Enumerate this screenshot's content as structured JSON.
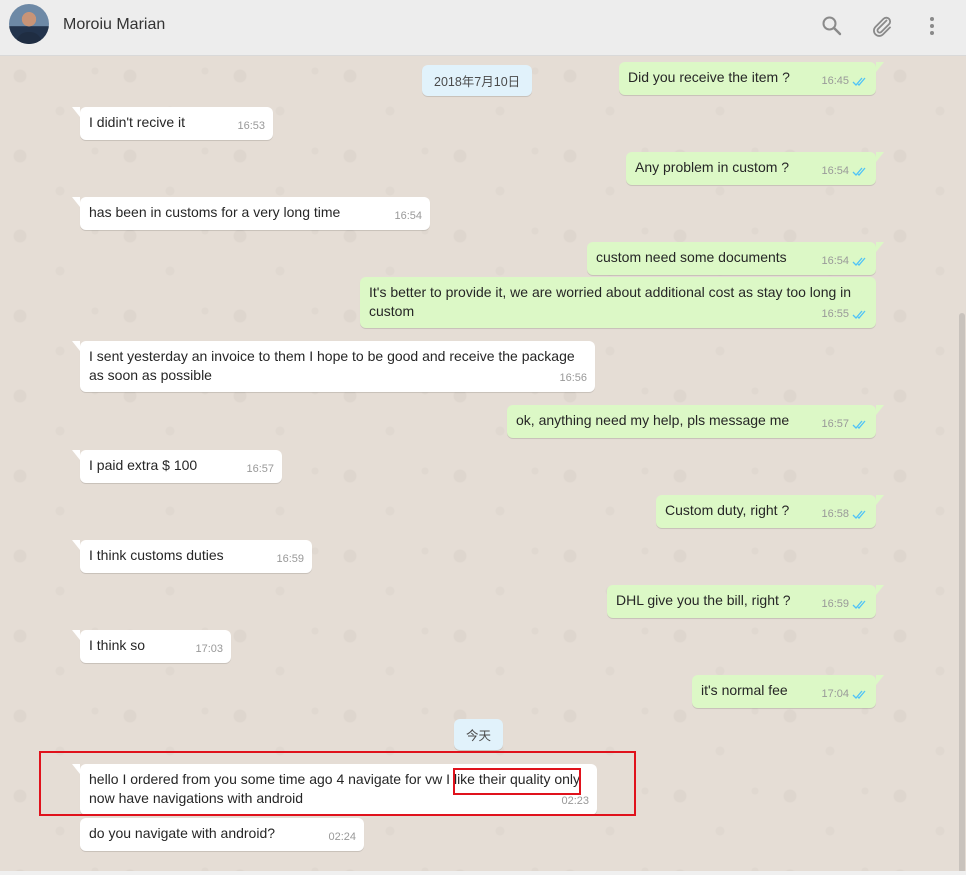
{
  "header": {
    "contact_name": "Moroiu Marian",
    "icons": [
      "search-icon",
      "attach-icon",
      "menu-icon"
    ]
  },
  "chat": {
    "date_separators": [
      "2018年7月10日",
      "今天"
    ],
    "messages": [
      {
        "dir": "out",
        "text": "Did you receive the item ?",
        "time": "16:45",
        "read": true
      },
      {
        "dir": "in",
        "text": "I didin't recive it",
        "time": "16:53"
      },
      {
        "dir": "out",
        "text": "Any problem in custom ?",
        "time": "16:54",
        "read": true
      },
      {
        "dir": "in",
        "text": "has been in customs for a very long time",
        "time": "16:54"
      },
      {
        "dir": "out",
        "text": "custom need some documents",
        "time": "16:54",
        "read": true
      },
      {
        "dir": "out",
        "text": "It's better to provide it,  we are worried about additional cost as stay too long in custom",
        "time": "16:55",
        "read": true
      },
      {
        "dir": "in",
        "text": "I sent yesterday an invoice to them I hope to be good and receive the package as soon as possible",
        "time": "16:56"
      },
      {
        "dir": "out",
        "text": "ok, anything need my help, pls message me",
        "time": "16:57",
        "read": true
      },
      {
        "dir": "in",
        "text": "I paid extra $ 100",
        "time": "16:57"
      },
      {
        "dir": "out",
        "text": "Custom duty, right ?",
        "time": "16:58",
        "read": true
      },
      {
        "dir": "in",
        "text": "I think customs duties",
        "time": "16:59"
      },
      {
        "dir": "out",
        "text": "DHL give you the bill, right ?",
        "time": "16:59",
        "read": true
      },
      {
        "dir": "in",
        "text": "I think so",
        "time": "17:03"
      },
      {
        "dir": "out",
        "text": "it's normal fee",
        "time": "17:04",
        "read": true
      },
      {
        "dir": "in",
        "text": "hello I ordered from you some time ago 4 navigate for vw I like their quality only now have navigations with android",
        "time": "02:23"
      },
      {
        "dir": "in",
        "text": "do you navigate with android?",
        "time": "02:24"
      }
    ]
  },
  "colors": {
    "outgoing_bubble": "#dcf8c6",
    "incoming_bubble": "#ffffff",
    "chat_background": "#e5ddd5",
    "read_ticks": "#4fc3f7",
    "annotation": "#e0121c"
  }
}
